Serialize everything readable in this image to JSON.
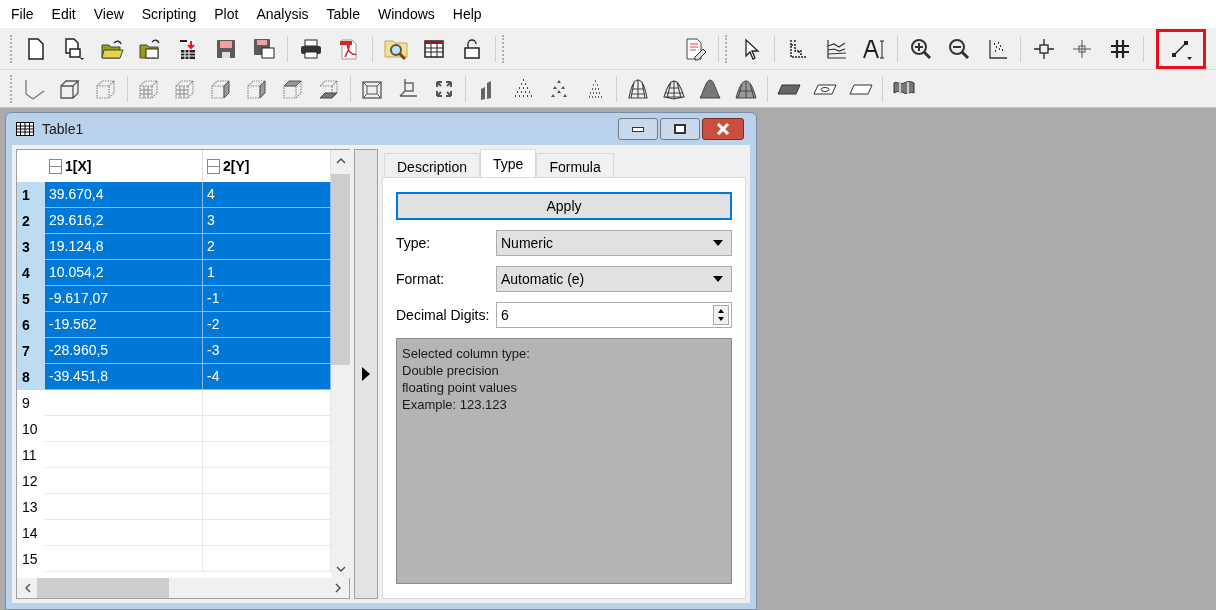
{
  "menu": [
    "File",
    "Edit",
    "View",
    "Scripting",
    "Plot",
    "Analysis",
    "Table",
    "Windows",
    "Help"
  ],
  "window": {
    "title": "Table1"
  },
  "table": {
    "columns": [
      "1[X]",
      "2[Y]"
    ],
    "rows": [
      {
        "label": "1",
        "cells": [
          "39.670,4",
          "4"
        ],
        "selected": true
      },
      {
        "label": "2",
        "cells": [
          "29.616,2",
          "3"
        ],
        "selected": true
      },
      {
        "label": "3",
        "cells": [
          "19.124,8",
          "2"
        ],
        "selected": true
      },
      {
        "label": "4",
        "cells": [
          "10.054,2",
          "1"
        ],
        "selected": true
      },
      {
        "label": "5",
        "cells": [
          "-9.617,07",
          "-1"
        ],
        "selected": true
      },
      {
        "label": "6",
        "cells": [
          "-19.562",
          "-2"
        ],
        "selected": true
      },
      {
        "label": "7",
        "cells": [
          "-28.960,5",
          "-3"
        ],
        "selected": true
      },
      {
        "label": "8",
        "cells": [
          "-39.451,8",
          "-4"
        ],
        "selected": true
      },
      {
        "label": "9",
        "cells": [],
        "selected": false
      },
      {
        "label": "10",
        "cells": [],
        "selected": false
      },
      {
        "label": "11",
        "cells": [],
        "selected": false
      },
      {
        "label": "12",
        "cells": [],
        "selected": false
      },
      {
        "label": "13",
        "cells": [],
        "selected": false
      },
      {
        "label": "14",
        "cells": [],
        "selected": false
      },
      {
        "label": "15",
        "cells": [],
        "selected": false
      }
    ]
  },
  "tabs": [
    {
      "label": "Description",
      "selected": false
    },
    {
      "label": "Type",
      "selected": true
    },
    {
      "label": "Formula",
      "selected": false
    }
  ],
  "apply_button": "Apply",
  "fields": [
    {
      "kind": "dropdown",
      "label": "Type:",
      "value": "Numeric"
    },
    {
      "kind": "dropdown",
      "label": "Format:",
      "value": "Automatic (e)"
    },
    {
      "kind": "spinbox",
      "label": "Decimal Digits:",
      "value": "6"
    }
  ],
  "info_text": [
    "Selected column type:",
    "Double precision",
    "floating point values",
    "Example: 123.123"
  ]
}
